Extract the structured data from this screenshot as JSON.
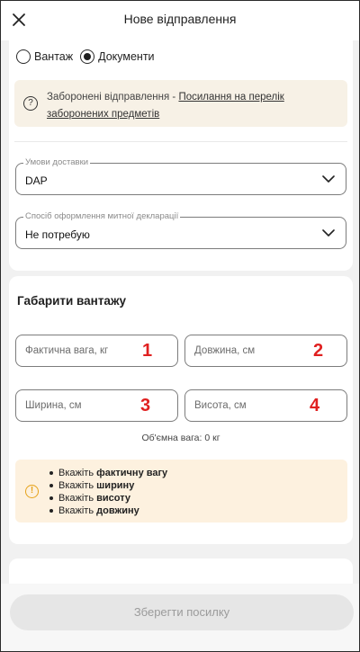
{
  "header": {
    "title": "Нове відправлення"
  },
  "shipment_type": {
    "options": [
      "Вантаж",
      "Документи"
    ],
    "selected": "Документи"
  },
  "prohibited_notice": {
    "text": "Заборонені відправлення - ",
    "link": "Посилання на перелік заборонених предметів"
  },
  "delivery_terms": {
    "label": "Умови доставки",
    "value": "DAP"
  },
  "customs": {
    "label": "Спосіб оформлення митної декларації",
    "value": "Не потребую"
  },
  "dimensions": {
    "title": "Габарити вантажу",
    "fields": [
      {
        "placeholder": "Фактична вага, кг",
        "badge": "1"
      },
      {
        "placeholder": "Довжина, см",
        "badge": "2"
      },
      {
        "placeholder": "Ширина, см",
        "badge": "3"
      },
      {
        "placeholder": "Висота, см",
        "badge": "4"
      }
    ],
    "volumetric_weight": "Об'ємна вага: 0 кг"
  },
  "requirements": [
    {
      "prefix": "Вкажіть ",
      "bold": "фактичну вагу"
    },
    {
      "prefix": "Вкажіть ",
      "bold": "ширину"
    },
    {
      "prefix": "Вкажіть ",
      "bold": "висоту"
    },
    {
      "prefix": "Вкажіть ",
      "bold": "довжину"
    }
  ],
  "footer": {
    "save_label": "Зберегти посилку"
  }
}
